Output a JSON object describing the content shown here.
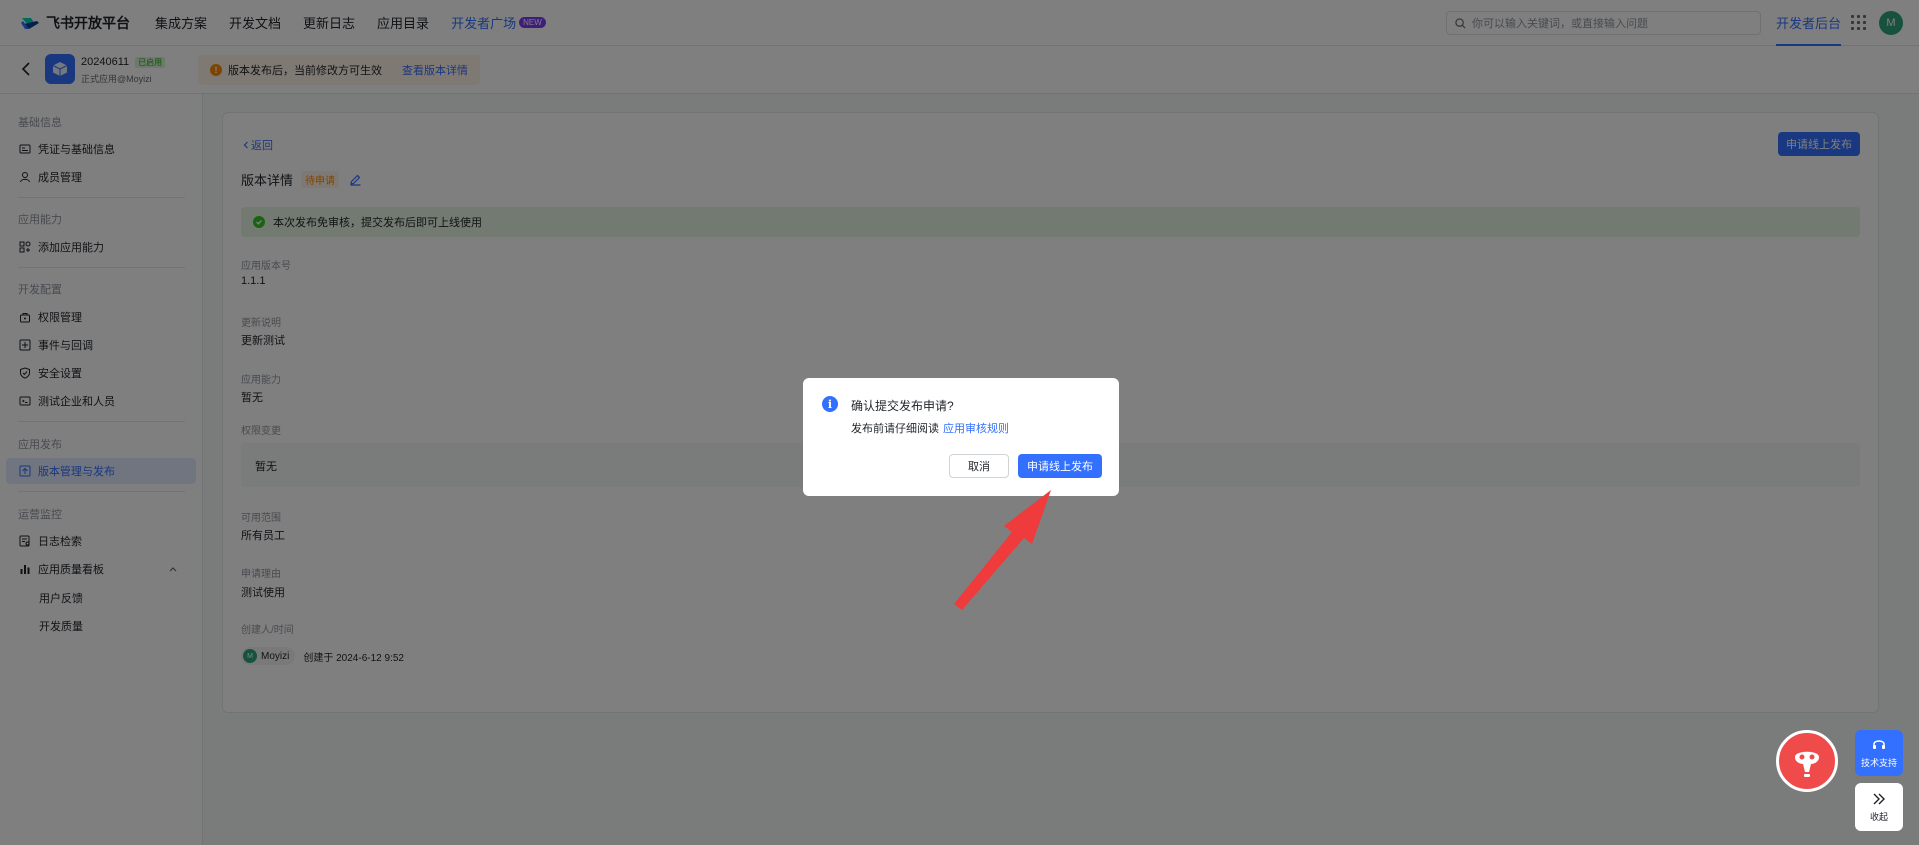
{
  "topnav": {
    "logo": "飞书开放平台",
    "items": [
      "集成方案",
      "开发文档",
      "更新日志",
      "应用目录"
    ],
    "developer_plaza": "开发者广场",
    "new_badge": "NEW",
    "search_placeholder": "你可以输入关键词，或直接输入问题",
    "console": "开发者后台",
    "avatar": "M"
  },
  "appbar": {
    "app_name": "20240611",
    "app_tag": "已启用",
    "app_sub": "正式应用@Moyizi",
    "notice": "版本发布后，当前修改方可生效",
    "notice_link": "查看版本详情"
  },
  "sidebar": {
    "groups": [
      {
        "title": "基础信息",
        "items": [
          "凭证与基础信息",
          "成员管理"
        ]
      },
      {
        "title": "应用能力",
        "items": [
          "添加应用能力"
        ]
      },
      {
        "title": "开发配置",
        "items": [
          "权限管理",
          "事件与回调",
          "安全设置",
          "测试企业和人员"
        ]
      },
      {
        "title": "应用发布",
        "items": [
          "版本管理与发布"
        ]
      },
      {
        "title": "运营监控",
        "items": [
          "日志检索",
          "应用质量看板"
        ]
      }
    ],
    "sub_items": [
      "用户反馈",
      "开发质量"
    ]
  },
  "main": {
    "back": "返回",
    "apply_button": "申请线上发布",
    "title": "版本详情",
    "status_tag": "待申请",
    "success_msg": "本次发布免审核，提交发布后即可上线使用",
    "fields": [
      {
        "label": "应用版本号",
        "value": "1.1.1"
      },
      {
        "label": "更新说明",
        "value": "更新测试"
      },
      {
        "label": "应用能力",
        "value": "暂无"
      },
      {
        "label": "权限变更",
        "value": "暂无"
      },
      {
        "label": "可用范围",
        "value": "所有员工"
      },
      {
        "label": "申请理由",
        "value": "测试使用"
      },
      {
        "label": "创建人/时间",
        "value": ""
      }
    ],
    "creator_avatar": "M",
    "creator_name": "Moyizi",
    "created_at": "创建于 2024-6-12 9:52"
  },
  "dialog": {
    "title": "确认提交发布申请?",
    "body": "发布前请仔细阅读",
    "link": "应用审核规则",
    "cancel": "取消",
    "confirm": "申请线上发布"
  },
  "floating": {
    "support": "技术支持",
    "collapse": "收起"
  },
  "colors": {
    "primary": "#3370ff",
    "warning": "#ff8800",
    "success": "#34c724",
    "annotation_arrow": "#ef3b3b"
  }
}
